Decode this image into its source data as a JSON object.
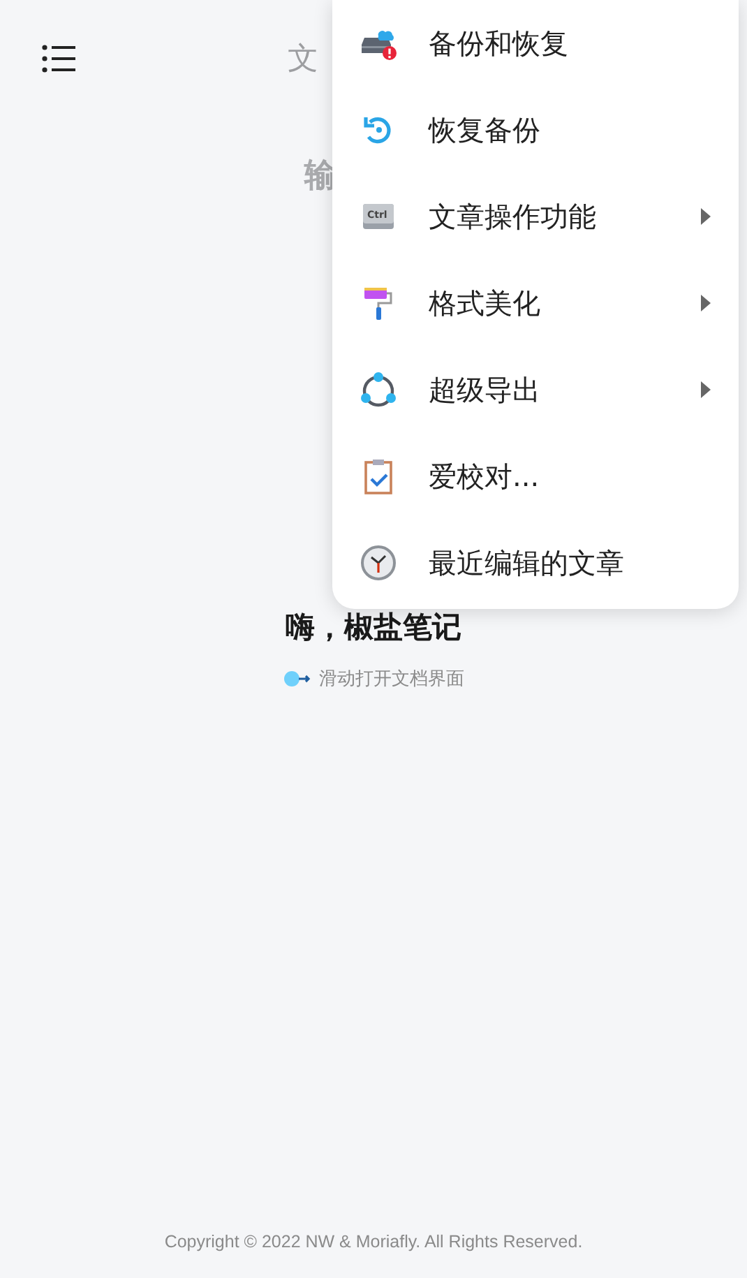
{
  "header": {
    "title": "文"
  },
  "editor": {
    "text_fragment": "输"
  },
  "welcome": {
    "title": "嗨，椒盐笔记",
    "hint": "滑动打开文档界面"
  },
  "footer": {
    "copyright": "Copyright © 2022 NW & Moriafly. All Rights Reserved."
  },
  "menu": {
    "items": [
      {
        "label": "备份和恢复",
        "kind": "backup",
        "submenu": false
      },
      {
        "label": "恢复备份",
        "kind": "restore",
        "submenu": false
      },
      {
        "label": "文章操作功能",
        "kind": "ctrl",
        "icon_text": "Ctrl",
        "submenu": true
      },
      {
        "label": "格式美化",
        "kind": "brush",
        "submenu": true
      },
      {
        "label": "超级导出",
        "kind": "export",
        "submenu": true
      },
      {
        "label": "爱校对...",
        "kind": "proofread",
        "submenu": false
      },
      {
        "label": "最近编辑的文章",
        "kind": "recent",
        "submenu": false
      }
    ]
  }
}
